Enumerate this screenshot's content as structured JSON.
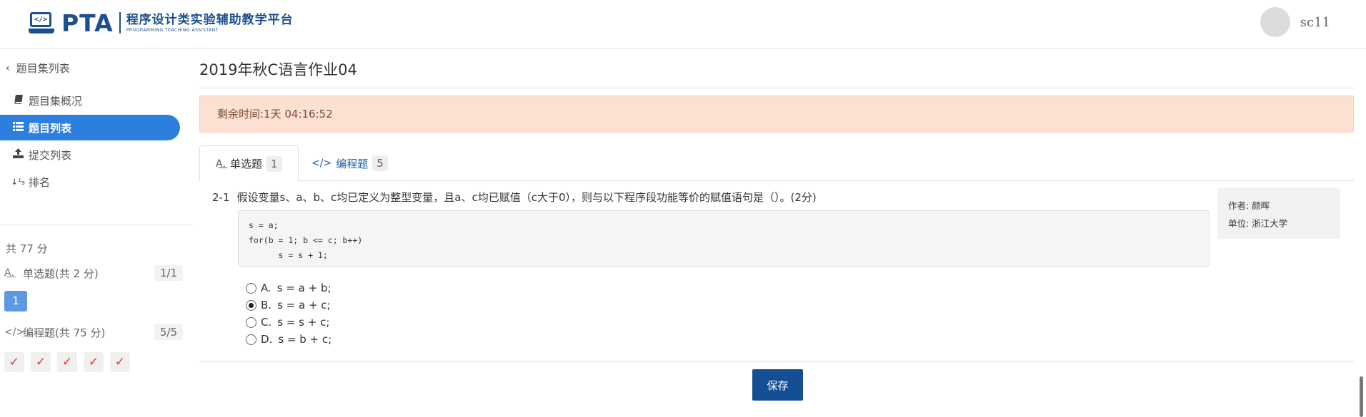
{
  "header": {
    "logo_code_glyph": "</>",
    "logo_text": "PTA",
    "logo_subtitle_cn": "程序设计类实验辅助教学平台",
    "logo_subtitle_en": "PROGRAMMING TEACHING ASSISTANT",
    "username": "sc11"
  },
  "sidebar": {
    "back_label": "题目集列表",
    "items": [
      {
        "label": "题目集概况",
        "icon": "book-icon",
        "active": false
      },
      {
        "label": "题目列表",
        "icon": "list-icon",
        "active": true
      },
      {
        "label": "提交列表",
        "icon": "upload-icon",
        "active": false
      },
      {
        "label": "排名",
        "icon": "sort-numeric-icon",
        "active": false
      }
    ],
    "total_score": "共 77 分",
    "groups": [
      {
        "label": "单选题(共 2 分)",
        "count": "1/1",
        "icon": "choice-icon"
      },
      {
        "label": "编程题(共 75 分)",
        "count": "5/5",
        "icon": "code-icon"
      }
    ],
    "single_choice_numbers": [
      "1"
    ],
    "programming_status": [
      "done",
      "done",
      "done",
      "done",
      "done"
    ]
  },
  "main": {
    "title": "2019年秋C语言作业04",
    "remaining_time": "剩余时间:1天 04:16:52",
    "tabs": [
      {
        "label": "单选题",
        "count": "1",
        "icon": "choice-icon",
        "active": true
      },
      {
        "label": "编程题",
        "count": "5",
        "icon": "code-icon",
        "active": false
      }
    ],
    "question": {
      "number": "2-1",
      "text": "假设变量s、a、b、c均已定义为整型变量，且a、c均已赋值（c大于0），则与以下程序段功能等价的赋值语句是（）。(2分)",
      "code_lines": [
        "s = a;",
        "for(b = 1; b <= c; b++)",
        "      s = s + 1;"
      ],
      "options": [
        {
          "letter": "A.",
          "text": "s = a + b;",
          "selected": false
        },
        {
          "letter": "B.",
          "text": "s = a + c;",
          "selected": true
        },
        {
          "letter": "C.",
          "text": "s = s + c;",
          "selected": false
        },
        {
          "letter": "D.",
          "text": "s = b + c;",
          "selected": false
        }
      ],
      "author_label": "作者: 颜晖",
      "org_label": "单位: 浙江大学"
    },
    "save_label": "保存"
  },
  "colors": {
    "brand": "#1d4f8f",
    "active_nav": "#2c7fdf",
    "timer_bg": "#fce1d3",
    "save_button": "#154f93",
    "check_mark": "#e53935"
  }
}
